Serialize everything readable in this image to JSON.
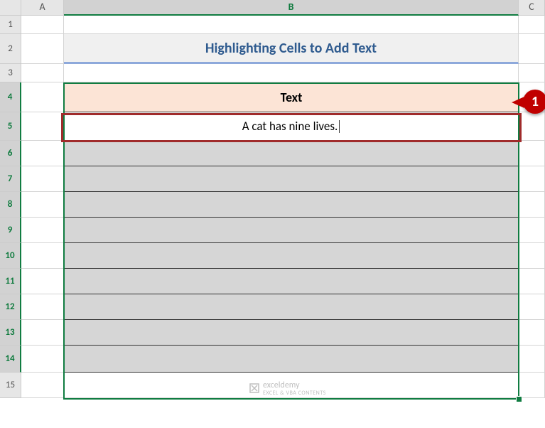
{
  "columns": {
    "A": "A",
    "B": "B",
    "C": "C"
  },
  "rows": [
    "1",
    "2",
    "3",
    "4",
    "5",
    "6",
    "7",
    "8",
    "9",
    "10",
    "11",
    "12",
    "13",
    "14",
    "15"
  ],
  "title": "Highlighting Cells to Add Text",
  "table_header": "Text",
  "edit_value": "A cat has nine lives.",
  "callout": "1",
  "watermark": {
    "brand": "exceldemy",
    "tagline": "EXCEL & VBA CONTENTS"
  }
}
